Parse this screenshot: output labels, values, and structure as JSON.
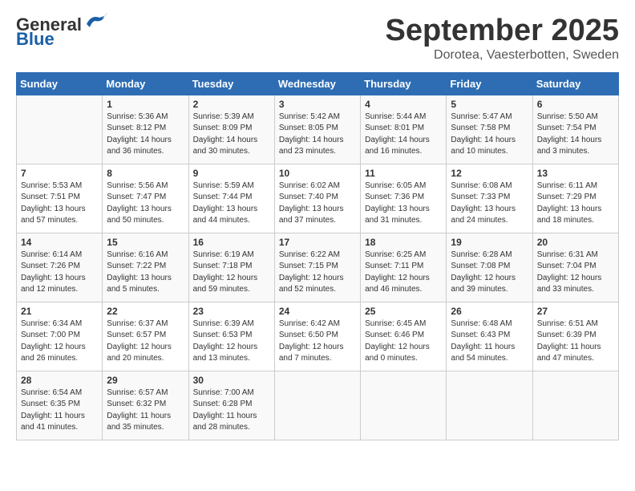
{
  "header": {
    "logo_general": "General",
    "logo_blue": "Blue",
    "month_title": "September 2025",
    "location": "Dorotea, Vaesterbotten, Sweden"
  },
  "days_of_week": [
    "Sunday",
    "Monday",
    "Tuesday",
    "Wednesday",
    "Thursday",
    "Friday",
    "Saturday"
  ],
  "weeks": [
    [
      {
        "day": "",
        "sunrise": "",
        "sunset": "",
        "daylight": ""
      },
      {
        "day": "1",
        "sunrise": "Sunrise: 5:36 AM",
        "sunset": "Sunset: 8:12 PM",
        "daylight": "Daylight: 14 hours and 36 minutes."
      },
      {
        "day": "2",
        "sunrise": "Sunrise: 5:39 AM",
        "sunset": "Sunset: 8:09 PM",
        "daylight": "Daylight: 14 hours and 30 minutes."
      },
      {
        "day": "3",
        "sunrise": "Sunrise: 5:42 AM",
        "sunset": "Sunset: 8:05 PM",
        "daylight": "Daylight: 14 hours and 23 minutes."
      },
      {
        "day": "4",
        "sunrise": "Sunrise: 5:44 AM",
        "sunset": "Sunset: 8:01 PM",
        "daylight": "Daylight: 14 hours and 16 minutes."
      },
      {
        "day": "5",
        "sunrise": "Sunrise: 5:47 AM",
        "sunset": "Sunset: 7:58 PM",
        "daylight": "Daylight: 14 hours and 10 minutes."
      },
      {
        "day": "6",
        "sunrise": "Sunrise: 5:50 AM",
        "sunset": "Sunset: 7:54 PM",
        "daylight": "Daylight: 14 hours and 3 minutes."
      }
    ],
    [
      {
        "day": "7",
        "sunrise": "Sunrise: 5:53 AM",
        "sunset": "Sunset: 7:51 PM",
        "daylight": "Daylight: 13 hours and 57 minutes."
      },
      {
        "day": "8",
        "sunrise": "Sunrise: 5:56 AM",
        "sunset": "Sunset: 7:47 PM",
        "daylight": "Daylight: 13 hours and 50 minutes."
      },
      {
        "day": "9",
        "sunrise": "Sunrise: 5:59 AM",
        "sunset": "Sunset: 7:44 PM",
        "daylight": "Daylight: 13 hours and 44 minutes."
      },
      {
        "day": "10",
        "sunrise": "Sunrise: 6:02 AM",
        "sunset": "Sunset: 7:40 PM",
        "daylight": "Daylight: 13 hours and 37 minutes."
      },
      {
        "day": "11",
        "sunrise": "Sunrise: 6:05 AM",
        "sunset": "Sunset: 7:36 PM",
        "daylight": "Daylight: 13 hours and 31 minutes."
      },
      {
        "day": "12",
        "sunrise": "Sunrise: 6:08 AM",
        "sunset": "Sunset: 7:33 PM",
        "daylight": "Daylight: 13 hours and 24 minutes."
      },
      {
        "day": "13",
        "sunrise": "Sunrise: 6:11 AM",
        "sunset": "Sunset: 7:29 PM",
        "daylight": "Daylight: 13 hours and 18 minutes."
      }
    ],
    [
      {
        "day": "14",
        "sunrise": "Sunrise: 6:14 AM",
        "sunset": "Sunset: 7:26 PM",
        "daylight": "Daylight: 13 hours and 12 minutes."
      },
      {
        "day": "15",
        "sunrise": "Sunrise: 6:16 AM",
        "sunset": "Sunset: 7:22 PM",
        "daylight": "Daylight: 13 hours and 5 minutes."
      },
      {
        "day": "16",
        "sunrise": "Sunrise: 6:19 AM",
        "sunset": "Sunset: 7:18 PM",
        "daylight": "Daylight: 12 hours and 59 minutes."
      },
      {
        "day": "17",
        "sunrise": "Sunrise: 6:22 AM",
        "sunset": "Sunset: 7:15 PM",
        "daylight": "Daylight: 12 hours and 52 minutes."
      },
      {
        "day": "18",
        "sunrise": "Sunrise: 6:25 AM",
        "sunset": "Sunset: 7:11 PM",
        "daylight": "Daylight: 12 hours and 46 minutes."
      },
      {
        "day": "19",
        "sunrise": "Sunrise: 6:28 AM",
        "sunset": "Sunset: 7:08 PM",
        "daylight": "Daylight: 12 hours and 39 minutes."
      },
      {
        "day": "20",
        "sunrise": "Sunrise: 6:31 AM",
        "sunset": "Sunset: 7:04 PM",
        "daylight": "Daylight: 12 hours and 33 minutes."
      }
    ],
    [
      {
        "day": "21",
        "sunrise": "Sunrise: 6:34 AM",
        "sunset": "Sunset: 7:00 PM",
        "daylight": "Daylight: 12 hours and 26 minutes."
      },
      {
        "day": "22",
        "sunrise": "Sunrise: 6:37 AM",
        "sunset": "Sunset: 6:57 PM",
        "daylight": "Daylight: 12 hours and 20 minutes."
      },
      {
        "day": "23",
        "sunrise": "Sunrise: 6:39 AM",
        "sunset": "Sunset: 6:53 PM",
        "daylight": "Daylight: 12 hours and 13 minutes."
      },
      {
        "day": "24",
        "sunrise": "Sunrise: 6:42 AM",
        "sunset": "Sunset: 6:50 PM",
        "daylight": "Daylight: 12 hours and 7 minutes."
      },
      {
        "day": "25",
        "sunrise": "Sunrise: 6:45 AM",
        "sunset": "Sunset: 6:46 PM",
        "daylight": "Daylight: 12 hours and 0 minutes."
      },
      {
        "day": "26",
        "sunrise": "Sunrise: 6:48 AM",
        "sunset": "Sunset: 6:43 PM",
        "daylight": "Daylight: 11 hours and 54 minutes."
      },
      {
        "day": "27",
        "sunrise": "Sunrise: 6:51 AM",
        "sunset": "Sunset: 6:39 PM",
        "daylight": "Daylight: 11 hours and 47 minutes."
      }
    ],
    [
      {
        "day": "28",
        "sunrise": "Sunrise: 6:54 AM",
        "sunset": "Sunset: 6:35 PM",
        "daylight": "Daylight: 11 hours and 41 minutes."
      },
      {
        "day": "29",
        "sunrise": "Sunrise: 6:57 AM",
        "sunset": "Sunset: 6:32 PM",
        "daylight": "Daylight: 11 hours and 35 minutes."
      },
      {
        "day": "30",
        "sunrise": "Sunrise: 7:00 AM",
        "sunset": "Sunset: 6:28 PM",
        "daylight": "Daylight: 11 hours and 28 minutes."
      },
      {
        "day": "",
        "sunrise": "",
        "sunset": "",
        "daylight": ""
      },
      {
        "day": "",
        "sunrise": "",
        "sunset": "",
        "daylight": ""
      },
      {
        "day": "",
        "sunrise": "",
        "sunset": "",
        "daylight": ""
      },
      {
        "day": "",
        "sunrise": "",
        "sunset": "",
        "daylight": ""
      }
    ]
  ]
}
